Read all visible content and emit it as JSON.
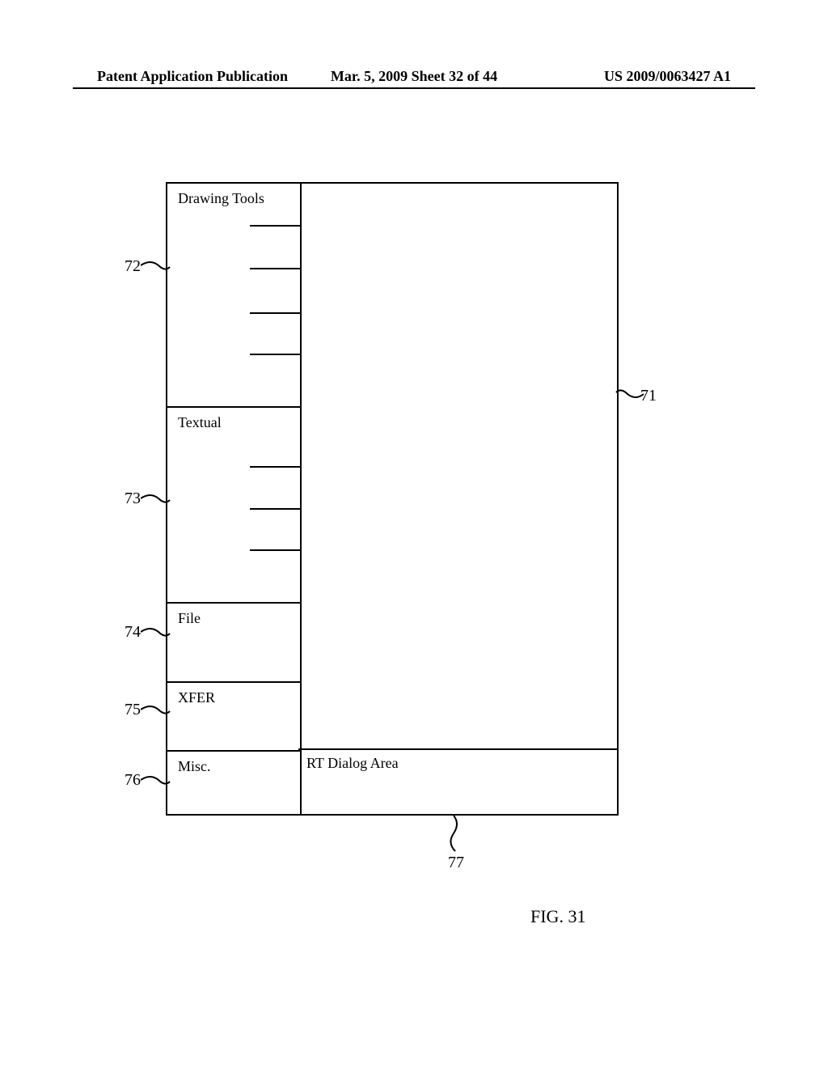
{
  "header": {
    "left": "Patent Application Publication",
    "center": "Mar. 5, 2009  Sheet 32 of 44",
    "right": "US 2009/0063427 A1"
  },
  "sidebar": {
    "sections": [
      {
        "title": "Drawing Tools"
      },
      {
        "title": "Textual"
      },
      {
        "title": "File"
      },
      {
        "title": "XFER"
      },
      {
        "title": "Misc."
      }
    ]
  },
  "dialog": {
    "title": "RT Dialog Area"
  },
  "refs": {
    "r72": "72",
    "r73": "73",
    "r74": "74",
    "r75": "75",
    "r76": "76",
    "r71": "71",
    "r77": "77"
  },
  "figure": "FIG. 31"
}
